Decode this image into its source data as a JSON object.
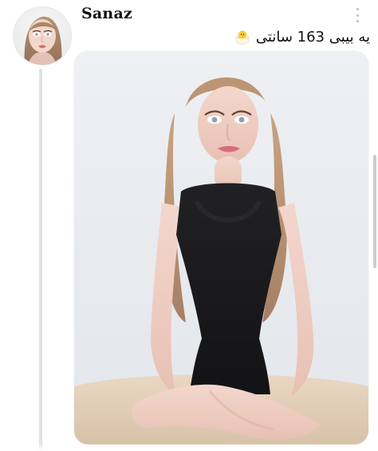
{
  "post": {
    "author": {
      "name": "Sanaz"
    },
    "caption": "یه بیبی 163 سانتی",
    "caption_emoji": "hatching-chick-emoji",
    "more_icon": "more-vertical-icon"
  },
  "colors": {
    "background": "#ffffff",
    "thread_line": "#dfe3e7",
    "username_text": "#111111",
    "icon_muted": "#b9bec5"
  }
}
